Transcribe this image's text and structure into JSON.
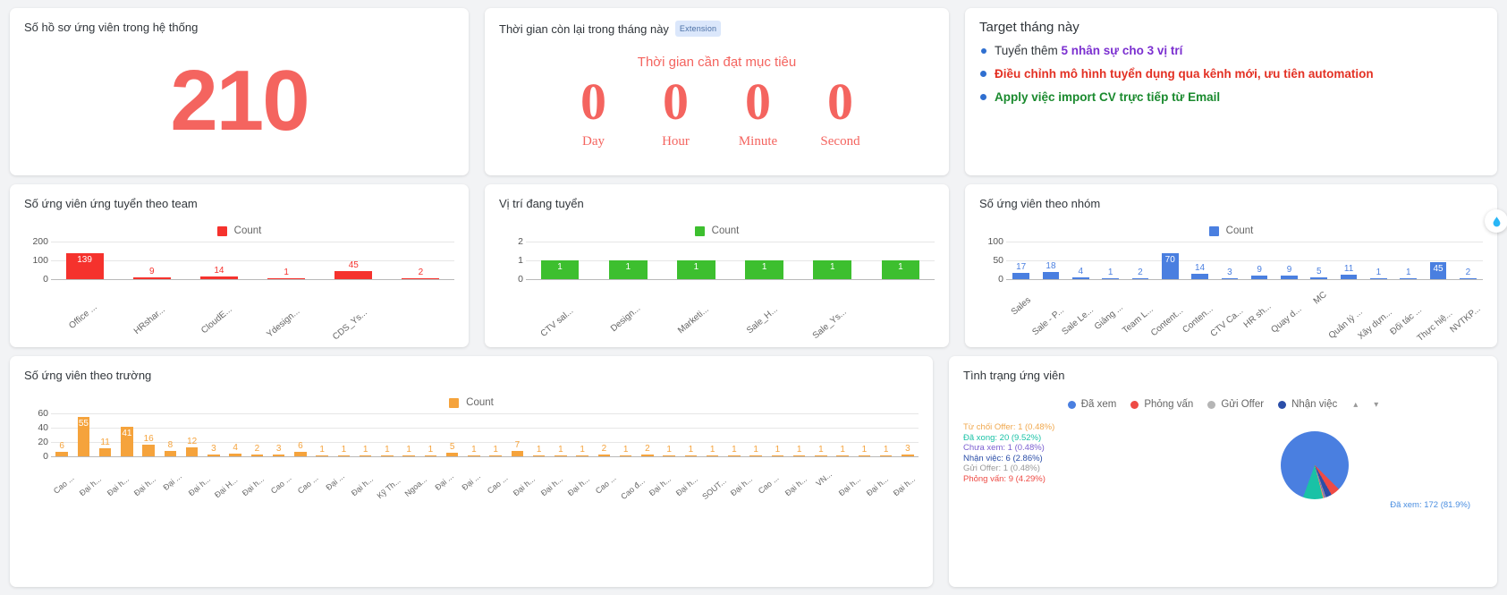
{
  "cards": {
    "profiles": {
      "title": "Số hồ sơ ứng viên trong hệ thống",
      "value": "210",
      "color": "#f4645f"
    },
    "timer": {
      "title": "Thời gian còn lại trong tháng này",
      "badge": "Extension",
      "subtitle": "Thời gian cần đạt mục tiêu",
      "color": "#f4645f",
      "units": [
        {
          "value": "0",
          "label": "Day"
        },
        {
          "value": "0",
          "label": "Hour"
        },
        {
          "value": "0",
          "label": "Minute"
        },
        {
          "value": "0",
          "label": "Second"
        }
      ]
    },
    "target": {
      "title": "Target tháng này",
      "items": [
        {
          "lead": "Tuyển thêm ",
          "highlight": "5 nhân sự cho 3 vị trí",
          "color": "#7b2fd0",
          "bold": false
        },
        {
          "lead": "",
          "highlight": "Điều chỉnh mô hình tuyển dụng qua kênh mới, ưu tiên automation",
          "color": "#e33124",
          "bold": true
        },
        {
          "lead": "",
          "highlight": "Apply việc import CV trực tiếp từ Email",
          "color": "#1a8a2e",
          "bold": true
        }
      ]
    }
  },
  "chart_data": [
    {
      "id": "team",
      "type": "bar",
      "title": "Số ứng viên ứng tuyển theo team",
      "legend": "Count",
      "color": "#f5322d",
      "categories": [
        "Office ...",
        "HRshar...",
        "CloudE...",
        "Ydesign...",
        "CDS_Ys...",
        ""
      ],
      "values": [
        139,
        9,
        14,
        1,
        45,
        2
      ],
      "yticks": [
        0,
        100,
        200
      ],
      "ylim": [
        0,
        200
      ],
      "xlabel": "",
      "ylabel": "",
      "grid": true,
      "legend_position": "top"
    },
    {
      "id": "positions",
      "type": "bar",
      "title": "Vị trí đang tuyển",
      "legend": "Count",
      "color": "#3dbf2f",
      "categories": [
        "CTV sal...",
        "Design...",
        "Marketi...",
        "Sale_H...",
        "Sale_Ys...",
        ""
      ],
      "values": [
        1,
        1,
        1,
        1,
        1,
        1
      ],
      "yticks": [
        0,
        1,
        2
      ],
      "ylim": [
        0,
        2
      ],
      "xlabel": "",
      "ylabel": "",
      "grid": true,
      "legend_position": "top"
    },
    {
      "id": "groups",
      "type": "bar",
      "title": "Số ứng viên theo nhóm",
      "legend": "Count",
      "color": "#4a7fe0",
      "categories": [
        "Sales",
        "Sale - P...",
        "Sale Le...",
        "Giảng ...",
        "Team L...",
        "Content...",
        "Conten...",
        "CTV Ca...",
        "HR sh...",
        "Quay d...",
        "MC",
        "Quản lý ...",
        "Xây dựn...",
        "Đối tác ...",
        "Thực hiệ...",
        "NVTKP..."
      ],
      "values": [
        17,
        18,
        4,
        1,
        2,
        70,
        14,
        3,
        9,
        9,
        5,
        11,
        1,
        1,
        45,
        2
      ],
      "yticks": [
        0,
        50,
        100
      ],
      "ylim": [
        0,
        100
      ],
      "xlabel": "",
      "ylabel": "",
      "grid": true,
      "legend_position": "top"
    },
    {
      "id": "schools",
      "type": "bar",
      "title": "Số ứng viên theo trường",
      "legend": "Count",
      "color": "#f5a33c",
      "categories": [
        "Cao ...",
        "Đại h...",
        "Đại h...",
        "Đại h...",
        "Đại ...",
        "Đại h...",
        "Đại H...",
        "Đại h...",
        "Cao ...",
        "Cao ...",
        "Đại ...",
        "Đại h...",
        "Kỹ Th...",
        "Ngoa...",
        "Đại ...",
        "Đại ...",
        "Cao ...",
        "Đại h...",
        "Đại h...",
        "Đại h...",
        "Cao ...",
        "Cao đ...",
        "Đại h...",
        "Đại h...",
        "SOUT...",
        "Đại h...",
        "Cao ...",
        "Đại h...",
        "VN...",
        "Đại h...",
        "Đại h...",
        "Đại h..."
      ],
      "values": [
        6,
        55,
        11,
        41,
        16,
        8,
        12,
        3,
        4,
        2,
        3,
        6,
        1,
        1,
        1,
        1,
        1,
        1,
        5,
        1,
        1,
        7,
        1,
        1,
        1,
        2,
        1,
        2,
        1,
        1,
        1,
        1,
        1,
        1,
        1,
        1,
        1,
        1,
        1,
        3
      ],
      "yticks": [
        0,
        20,
        40,
        60
      ],
      "ylim": [
        0,
        60
      ],
      "xlabel": "",
      "ylabel": "",
      "grid": true,
      "legend_position": "top"
    },
    {
      "id": "status",
      "type": "pie",
      "title": "Tình trạng ứng viên",
      "legend_position": "top",
      "legend": [
        {
          "label": "Đã xem",
          "color": "#4a7fe0"
        },
        {
          "label": "Phỏng vấn",
          "color": "#ee4b45"
        },
        {
          "label": "Gửi Offer",
          "color": "#b5b5b5"
        },
        {
          "label": "Nhận việc",
          "color": "#2b4ea8"
        }
      ],
      "slices": [
        {
          "label": "Từ chối Offer",
          "count": 1,
          "percent": "0.48%",
          "text": "Từ chối Offer: 1 (0.48%)",
          "color": "#f0a84e"
        },
        {
          "label": "Đã xong",
          "count": 20,
          "percent": "9.52%",
          "text": "Đã xong: 20 (9.52%)",
          "color": "#19c2a6"
        },
        {
          "label": "Chưa xem",
          "count": 1,
          "percent": "0.48%",
          "text": "Chưa xem: 1 (0.48%)",
          "color": "#7b5fd0"
        },
        {
          "label": "Nhận việc",
          "count": 6,
          "percent": "2.86%",
          "text": "Nhận việc: 6 (2.86%)",
          "color": "#2b4ea8"
        },
        {
          "label": "Gửi Offer",
          "count": 1,
          "percent": "0.48%",
          "text": "Gửi Offer: 1 (0.48%)",
          "color": "#9a9a9a"
        },
        {
          "label": "Phỏng vấn",
          "count": 9,
          "percent": "4.29%",
          "text": "Phỏng vấn: 9 (4.29%)",
          "color": "#ee4b45"
        },
        {
          "label": "Đã xem",
          "count": 172,
          "percent": "81.9%",
          "text": "Đã xem: 172 (81.9%)",
          "color": "#4a7fe0"
        }
      ]
    }
  ],
  "fab": {
    "icon": "droplet-icon"
  }
}
